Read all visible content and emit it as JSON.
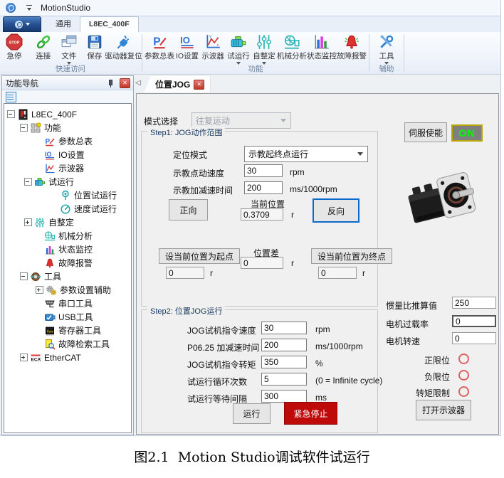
{
  "window": {
    "title": "MotionStudio"
  },
  "ribbon": {
    "tabs": [
      {
        "label": "通用"
      },
      {
        "label": "L8EC_400F"
      }
    ],
    "groups": [
      {
        "label": "快速访问",
        "items": [
          {
            "label": "急停"
          },
          {
            "label": "连接"
          },
          {
            "label": "文件"
          },
          {
            "label": "保存"
          },
          {
            "label": "驱动器复位"
          }
        ]
      },
      {
        "label": "功能",
        "items": [
          {
            "label": "参数总表"
          },
          {
            "label": "IO设置"
          },
          {
            "label": "示波器"
          },
          {
            "label": "试运行"
          },
          {
            "label": "自整定"
          },
          {
            "label": "机械分析"
          },
          {
            "label": "状态监控"
          },
          {
            "label": "故障报警"
          }
        ]
      },
      {
        "label": "辅助",
        "items": [
          {
            "label": "工具"
          }
        ]
      }
    ]
  },
  "nav": {
    "title": "功能导航",
    "tree": [
      {
        "label": "L8EC_400F"
      },
      {
        "label": "功能"
      },
      {
        "label": "参数总表"
      },
      {
        "label": "IO设置"
      },
      {
        "label": "示波器"
      },
      {
        "label": "试运行"
      },
      {
        "label": "位置试运行"
      },
      {
        "label": "速度试运行"
      },
      {
        "label": "自整定"
      },
      {
        "label": "机械分析"
      },
      {
        "label": "状态监控"
      },
      {
        "label": "故障报警"
      },
      {
        "label": "工具"
      },
      {
        "label": "参数设置辅助"
      },
      {
        "label": "串口工具"
      },
      {
        "label": "USB工具"
      },
      {
        "label": "寄存器工具"
      },
      {
        "label": "故障检索工具"
      },
      {
        "label": "EtherCAT"
      }
    ]
  },
  "doc": {
    "tab": "位置JOG",
    "mode_label": "模式选择",
    "mode_value": "往复运动",
    "step1": {
      "title": "Step1: JOG动作范围",
      "pos_mode_label": "定位模式",
      "pos_mode_value": "示教起终点运行",
      "jog_speed_label": "示教点动速度",
      "jog_speed_value": "30",
      "jog_speed_unit": "rpm",
      "accel_label": "示教加减速时间",
      "accel_value": "200",
      "accel_unit": "ms/1000rpm",
      "forward_button": "正向",
      "current_pos_label": "当前位置",
      "current_pos_value": "0.3709",
      "current_pos_unit": "r",
      "reverse_button": "反向",
      "set_start_button": "设当前位置为起点",
      "pos_diff_label": "位置差",
      "pos_diff_value": "0",
      "pos_diff_unit": "r",
      "set_end_button": "设当前位置为终点",
      "start_value": "0",
      "start_unit": "r",
      "end_value": "0",
      "end_unit": "r"
    },
    "step2": {
      "title": "Step2: 位置JOG运行",
      "rows": [
        {
          "label": "JOG试机指令速度",
          "value": "30",
          "unit": "rpm"
        },
        {
          "label": "P06.25 加减速时间",
          "value": "200",
          "unit": "ms/1000rpm"
        },
        {
          "label": "JOG试机指令转矩",
          "value": "350",
          "unit": "%"
        },
        {
          "label": "试运行循环次数",
          "value": "5",
          "unit": "(0 = Infinite cycle)"
        },
        {
          "label": "试运行等待间隔",
          "value": "300",
          "unit": "ms"
        }
      ],
      "run_button": "运行",
      "estop_button": "紧急停止"
    },
    "right": {
      "servo_enable_button": "伺服使能",
      "servo_state": "ON",
      "inertia_label": "惯量比推算值",
      "inertia_value": "250",
      "overload_label": "电机过载率",
      "overload_value": "0",
      "speed_label": "电机转速",
      "speed_value": "0",
      "limits": [
        {
          "label": "正限位"
        },
        {
          "label": "负限位"
        },
        {
          "label": "转矩限制"
        }
      ],
      "open_scope_button": "打开示波器"
    }
  },
  "caption": "图2.1  Motion Studio调试软件试运行",
  "colors": {
    "estop_red": "#bf0a0a",
    "on_green": "#00ff00",
    "on_badge_bg": "#7f7f7f",
    "on_badge_border": "#b8a400",
    "limit_led_red": "#e06060",
    "app_button_blue": "#173a72",
    "legend_navy": "#17365d"
  }
}
